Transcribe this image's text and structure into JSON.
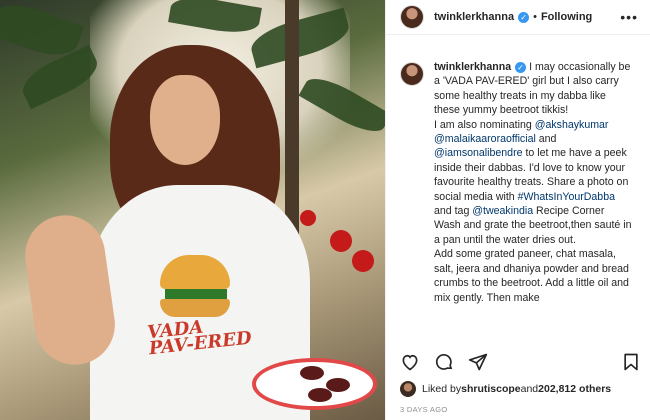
{
  "post": {
    "username": "twinklerkhanna",
    "verified_icon": "verified-badge-icon",
    "dot": "•",
    "follow_status": "Following",
    "more_label": "•••",
    "shirt_text_line1": "VADA",
    "shirt_text_line2": "PAV-ERED"
  },
  "caption": {
    "username": "twinklerkhanna",
    "line1": " I may occasionally be a 'VADA PAV-ERED' girl but I also carry some healthy treats in my dabba like these yummy beetroot tikkis!",
    "line2_prefix": "I am also nominating ",
    "mention1": "@akshaykumar",
    "mention2": "@malaikaaroraofficial",
    "and1": " and ",
    "mention3": "@iamsonalibendre",
    "line2_suffix": " to let me have a peek inside their dabbas. I'd love to know your favourite healthy treats. Share a photo on social media with ",
    "hashtag": "#WhatsInYourDabba",
    "and_tag": " and tag ",
    "mention4": "@tweakindia",
    "recipe_label": " Recipe Corner",
    "step1": "Wash and grate the beetroot,then sauté in a pan until the water dries out.",
    "step2": "Add some grated paneer, chat masala, salt, jeera and dhaniya powder and bread crumbs to the beetroot. Add a little oil and mix gently. Then make"
  },
  "actions": {
    "like_icon": "heart-icon",
    "comment_icon": "comment-icon",
    "share_icon": "share-icon",
    "save_icon": "bookmark-icon"
  },
  "likes": {
    "prefix": "Liked by ",
    "user": "shrutiscope",
    "middle": " and ",
    "count": "202,812 others"
  },
  "timestamp": "3 DAYS AGO",
  "colors": {
    "link": "#00376b",
    "verified": "#3897f0",
    "muted": "#8e8e8e"
  }
}
